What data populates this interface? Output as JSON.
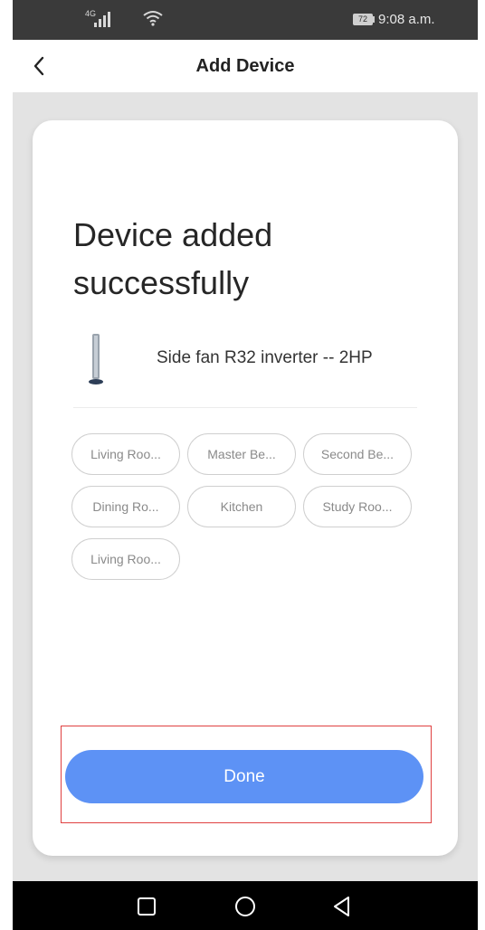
{
  "status_bar": {
    "network": "4G",
    "battery": "72",
    "time": "9:08 a.m.",
    "icons": [
      "signal-icon",
      "wifi-icon",
      "battery-icon"
    ]
  },
  "header": {
    "title": "Add Device",
    "back_icon": "chevron-left-icon"
  },
  "card": {
    "title": "Device added successfully",
    "device": {
      "name": "Side fan R32 inverter -- 2HP",
      "icon": "tower-unit-icon"
    },
    "rooms": [
      "Living Roo...",
      "Master Be...",
      "Second Be...",
      "Dining Ro...",
      "Kitchen",
      "Study Roo...",
      "Living Roo..."
    ],
    "done_label": "Done"
  },
  "nav_bar": {
    "icons": [
      "recent-apps-icon",
      "home-icon",
      "back-triangle-icon"
    ]
  },
  "colors": {
    "accent": "#5d92f5",
    "highlight": "#e04040",
    "status_bar_bg": "#3a3a3a",
    "page_bg": "#e3e3e3"
  }
}
